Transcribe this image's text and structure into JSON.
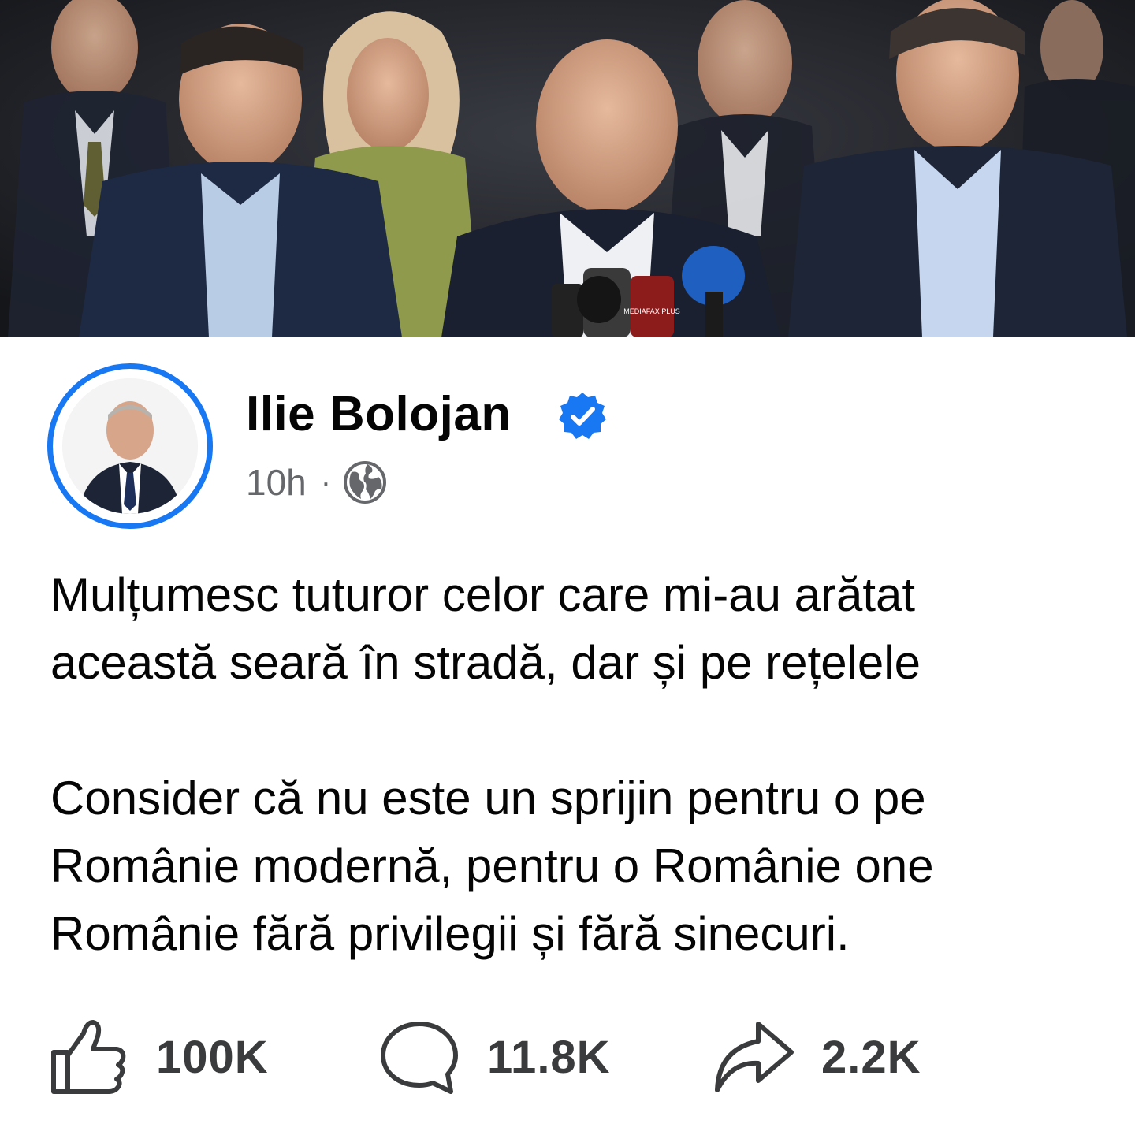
{
  "post": {
    "author": "Ilie Bolojan",
    "verified_icon": "verified-badge-icon",
    "time": "10h",
    "separator": "·",
    "audience_icon": "globe-icon",
    "paragraphs": [
      [
        "Mulțumesc tuturor celor care mi-au arătat",
        "această seară în stradă, dar și pe rețelele"
      ],
      [
        "Consider că nu este un sprijin pentru o pe",
        "Românie modernă, pentru o Românie one",
        "Românie fără privilegii și fără sinecuri."
      ]
    ]
  },
  "actions": {
    "like_count": "100K",
    "comment_count": "11.8K",
    "share_count": "2.2K"
  },
  "photo": {
    "overlay_text": "MEDIAFAX PLUS"
  },
  "colors": {
    "accent": "#1877f2",
    "text": "#050505",
    "secondary": "#65676b",
    "icon": "#3a3b3c"
  }
}
